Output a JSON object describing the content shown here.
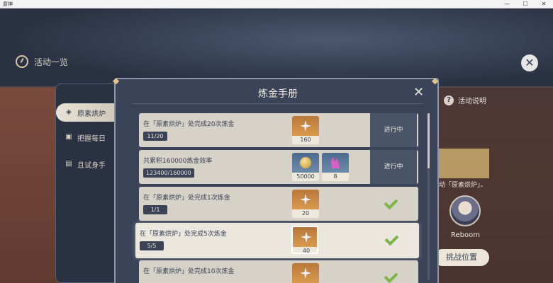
{
  "window": {
    "title": "原神",
    "min": "—",
    "max": "☐",
    "close": "✕"
  },
  "activity": {
    "title": "活动一览",
    "icon": "compass-icon"
  },
  "side_tabs": [
    {
      "label": "原素烘炉",
      "icon": "element-icon",
      "active": true
    },
    {
      "label": "把握每日",
      "icon": "calendar-icon",
      "active": false
    },
    {
      "label": "且试身手",
      "icon": "cards-icon",
      "active": false
    }
  ],
  "modal": {
    "title": "炼金手册",
    "close": "✕",
    "tasks": [
      {
        "name": "在「原素烘炉」处完成20次炼金",
        "progress": "11/20",
        "status": "进行中",
        "done": false,
        "highlight": false,
        "rewards": [
          {
            "icon": "primogem-icon",
            "count": "160",
            "rarity": "orange"
          }
        ]
      },
      {
        "name": "共累积160000炼金效率",
        "progress": "123400/160000",
        "status": "进行中",
        "done": false,
        "highlight": false,
        "rewards": [
          {
            "icon": "mora-icon",
            "count": "50000",
            "rarity": "blue"
          },
          {
            "icon": "crystal-icon",
            "count": "8",
            "rarity": "purple"
          }
        ]
      },
      {
        "name": "在「原素烘炉」处完成1次炼金",
        "progress": "1/1",
        "status": "",
        "done": true,
        "highlight": false,
        "rewards": [
          {
            "icon": "primogem-icon",
            "count": "20",
            "rarity": "orange"
          }
        ]
      },
      {
        "name": "在「原素烘炉」处完成5次炼金",
        "progress": "5/5",
        "status": "",
        "done": true,
        "highlight": true,
        "rewards": [
          {
            "icon": "primogem-icon",
            "count": "40",
            "rarity": "orange"
          }
        ]
      },
      {
        "name": "在「原素烘炉」处完成10次炼金",
        "progress": "",
        "status": "",
        "done": true,
        "highlight": false,
        "rewards": [
          {
            "icon": "primogem-icon",
            "count": "",
            "rarity": "orange"
          }
        ]
      }
    ]
  },
  "right": {
    "info_label": "活动说明",
    "tail_text": "动「原素烘炉」。",
    "player_name": "Reboom",
    "challenge_button": "挑战位置"
  },
  "colors": {
    "check": "#7bb54a",
    "modal_bg": "#3a4358",
    "row_bg": "#d7d2c8"
  }
}
